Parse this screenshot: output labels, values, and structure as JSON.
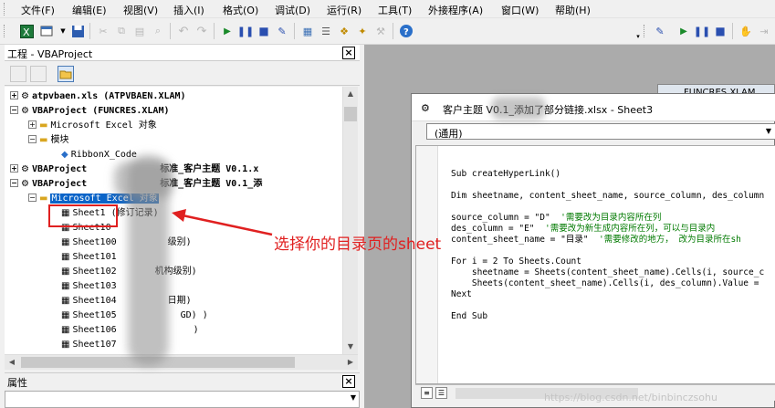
{
  "menu": {
    "file": "文件(F)",
    "edit": "编辑(E)",
    "view": "视图(V)",
    "insert": "插入(I)",
    "format": "格式(O)",
    "debug": "调试(D)",
    "run": "运行(R)",
    "tools": "工具(T)",
    "addins": "外接程序(A)",
    "window": "窗口(W)",
    "help": "帮助(H)"
  },
  "project_panel": {
    "title": "工程 - VBAProject",
    "tree": [
      {
        "expander": "+",
        "icon": "vba-project-icon",
        "label": "atpvbaen.xls (ATPVBAEN.XLAM)"
      },
      {
        "expander": "−",
        "icon": "vba-project-icon",
        "label": "VBAProject (FUNCRES.XLAM)"
      },
      {
        "expander": "+",
        "icon": "folder-icon",
        "label": "Microsoft Excel 对象"
      },
      {
        "expander": "−",
        "icon": "folder-icon",
        "label": "模块"
      },
      {
        "expander": "",
        "icon": "module-icon",
        "label": "RibbonX_Code"
      },
      {
        "expander": "+",
        "icon": "vba-project-icon",
        "label": "VBAProject",
        "suffix": "标准_客户主题 V0.1.x"
      },
      {
        "expander": "−",
        "icon": "vba-project-icon",
        "label": "VBAProject",
        "suffix": "标准_客户主题 V0.1_添"
      },
      {
        "expander": "−",
        "icon": "folder-icon",
        "label": "Microsoft Excel 对象"
      },
      {
        "expander": "",
        "icon": "sheet-icon",
        "label": "Sheet1 (修订记录)"
      },
      {
        "expander": "",
        "icon": "sheet-icon",
        "label": "Sheet10"
      },
      {
        "expander": "",
        "icon": "sheet-icon",
        "label": "Sheet100",
        "suffix": "级别)"
      },
      {
        "expander": "",
        "icon": "sheet-icon",
        "label": "Sheet101"
      },
      {
        "expander": "",
        "icon": "sheet-icon",
        "label": "Sheet102",
        "suffix": "机构级别)"
      },
      {
        "expander": "",
        "icon": "sheet-icon",
        "label": "Sheet103"
      },
      {
        "expander": "",
        "icon": "sheet-icon",
        "label": "Sheet104",
        "suffix": "日期)"
      },
      {
        "expander": "",
        "icon": "sheet-icon",
        "label": "Sheet105",
        "suffix": "GD) )"
      },
      {
        "expander": "",
        "icon": "sheet-icon",
        "label": "Sheet106",
        "suffix": ")"
      },
      {
        "expander": "",
        "icon": "sheet-icon",
        "label": "Sheet107"
      }
    ]
  },
  "properties_panel": {
    "title": "属性"
  },
  "background_window": {
    "title": "FUNCRES.XLAM"
  },
  "code_window": {
    "title": "客户主题 V0.1_添加了部分链接.xlsx - Sheet3",
    "object_combo": "(通用)",
    "lines": [
      {
        "code": "Sub createHyperLink()",
        "comment": ""
      },
      {
        "code": "",
        "comment": ""
      },
      {
        "code": "Dim sheetname, content_sheet_name, source_column, des_column",
        "comment": ""
      },
      {
        "code": "",
        "comment": ""
      },
      {
        "code": "source_column = \"D\"",
        "comment": "'需要改为目录内容所在列"
      },
      {
        "code": "des_column = \"E\"",
        "comment": "'需要改为新生成内容所在列，可以与目录内"
      },
      {
        "code": "content_sheet_name = \"目录\"",
        "comment": "'需要修改的地方， 改为目录所在sh"
      },
      {
        "code": "",
        "comment": ""
      },
      {
        "code": "For i = 2 To Sheets.Count",
        "comment": ""
      },
      {
        "code": "    sheetname = Sheets(content_sheet_name).Cells(i, source_c",
        "comment": ""
      },
      {
        "code": "    Sheets(content_sheet_name).Cells(i, des_column).Value =",
        "comment": ""
      },
      {
        "code": "Next",
        "comment": ""
      },
      {
        "code": "",
        "comment": ""
      },
      {
        "code": "End Sub",
        "comment": ""
      }
    ]
  },
  "annotation": {
    "text": "选择你的目录页的sheet",
    "color": "#e02020"
  },
  "watermark": "https://blog.csdn.net/binbinczsohu"
}
